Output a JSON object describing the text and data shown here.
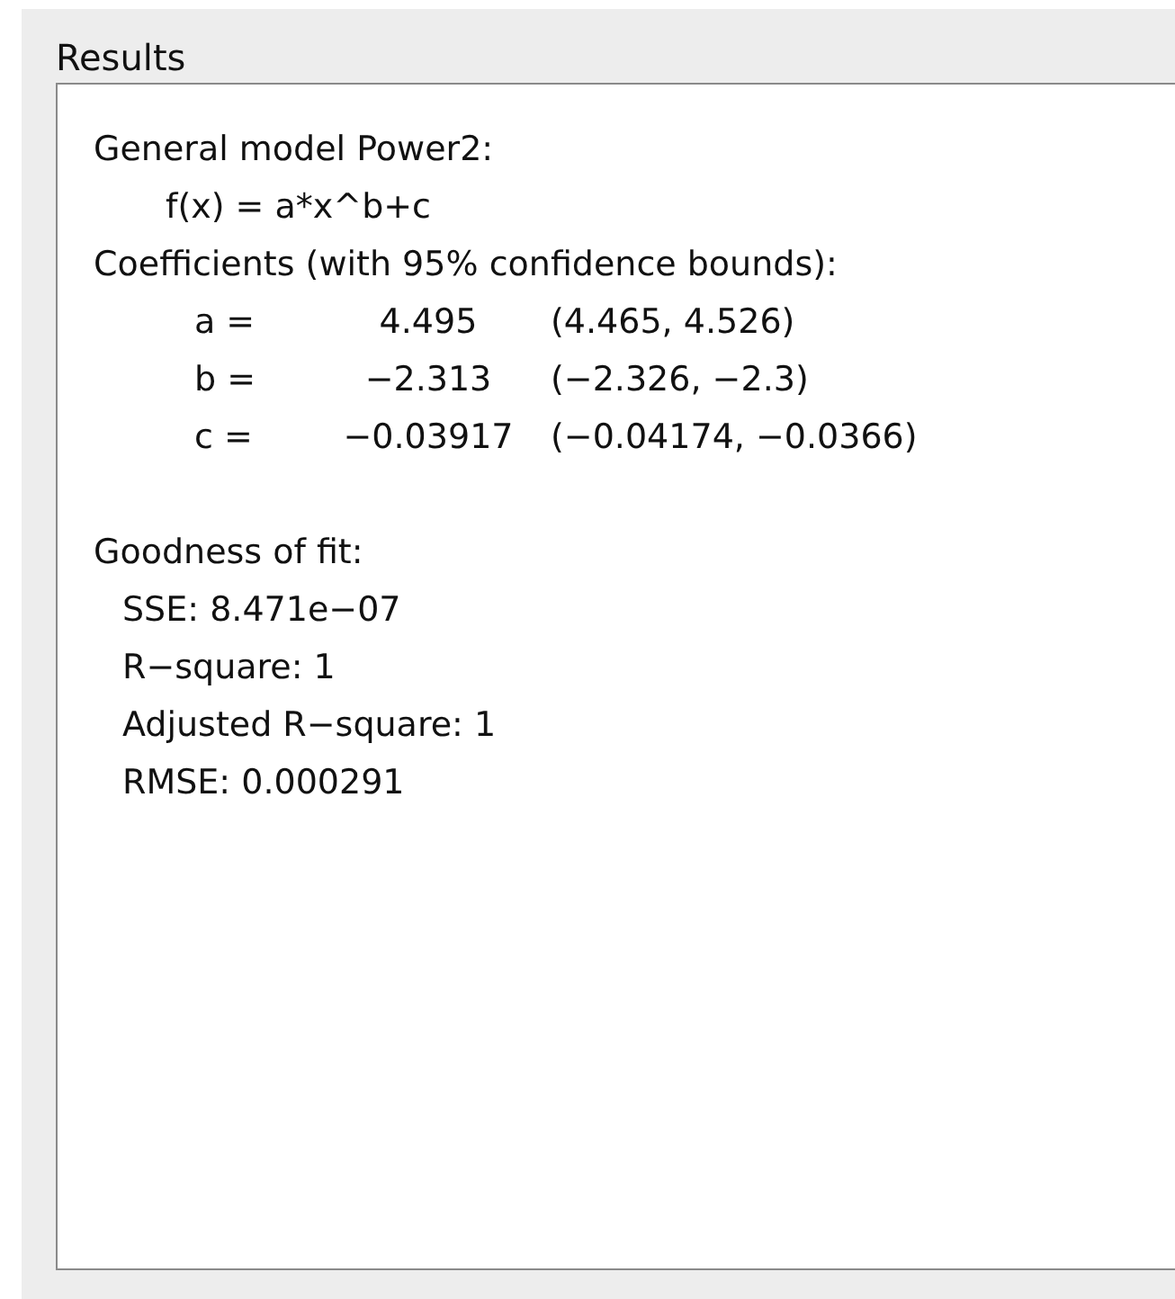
{
  "panel": {
    "title": "Results"
  },
  "model": {
    "heading": "General model Power2:",
    "formula": "f(x) = a*x^b+c"
  },
  "coefficients": {
    "heading": "Coefficients (with 95% confidence bounds):",
    "rows": [
      {
        "label": "a =",
        "value": "4.495",
        "bounds": "(4.465, 4.526)"
      },
      {
        "label": "b =",
        "value": "−2.313",
        "bounds": "(−2.326, −2.3)"
      },
      {
        "label": "c =",
        "value": "−0.03917",
        "bounds": "(−0.04174, −0.0366)"
      }
    ]
  },
  "goodness": {
    "heading": "Goodness of fit:",
    "stats": [
      "SSE: 8.471e−07",
      "R−square: 1",
      "Adjusted R−square: 1",
      "RMSE: 0.000291"
    ]
  }
}
